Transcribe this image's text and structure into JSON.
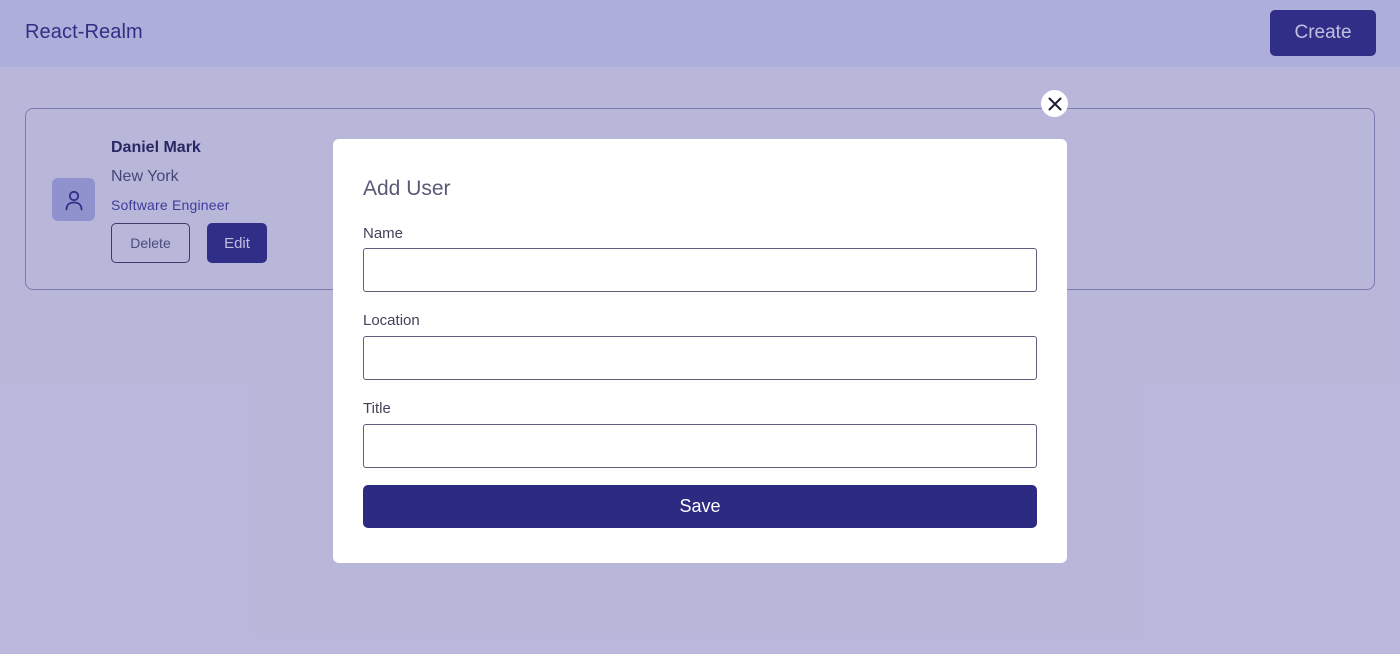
{
  "app": {
    "title": "React-Realm"
  },
  "header": {
    "create_label": "Create"
  },
  "users": [
    {
      "name": "Daniel Mark",
      "location": "New York",
      "title": "Software Engineer",
      "delete_label": "Delete",
      "edit_label": "Edit",
      "avatar_icon": "user-icon"
    }
  ],
  "modal": {
    "title": "Add User",
    "close_icon": "close-icon",
    "fields": [
      {
        "label": "Name",
        "value": "",
        "placeholder": ""
      },
      {
        "label": "Location",
        "value": "",
        "placeholder": ""
      },
      {
        "label": "Title",
        "value": "",
        "placeholder": ""
      }
    ],
    "save_label": "Save"
  },
  "colors": {
    "primary": "#2d2a82",
    "header_bg": "#e3e6fb",
    "overlay": "rgba(60, 55, 150, 0.32)",
    "avatar_bg": "#b9bde9",
    "link_text": "#3f3fa0"
  }
}
